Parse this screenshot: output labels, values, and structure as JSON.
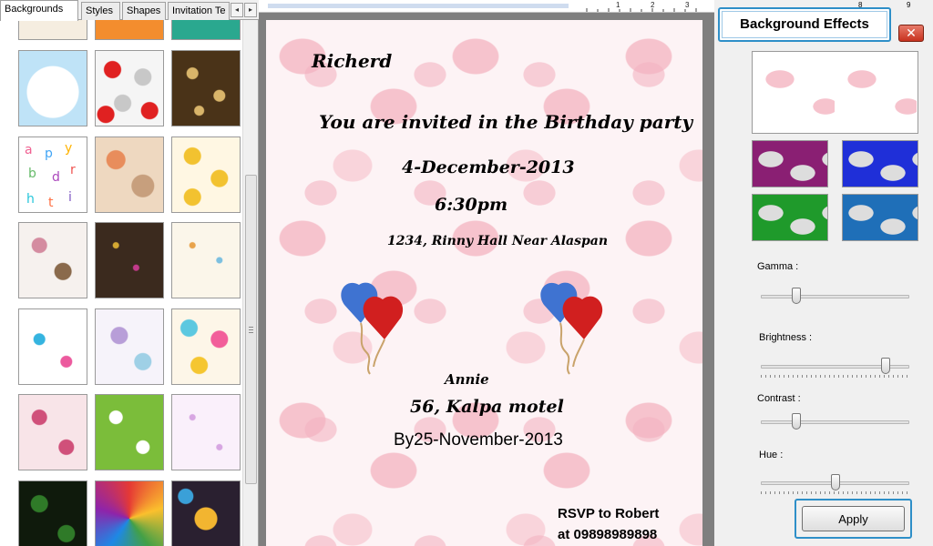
{
  "tabs": [
    {
      "label": "Backgrounds",
      "active": true
    },
    {
      "label": "Styles",
      "active": false
    },
    {
      "label": "Shapes",
      "active": false
    },
    {
      "label": "Invitation Te",
      "active": false
    }
  ],
  "tab_scroll": {
    "left": "◂",
    "right": "▸"
  },
  "ruler_numbers": [
    "1",
    "2",
    "3",
    "8",
    "9"
  ],
  "card": {
    "name": "Richerd",
    "invite": "You are invited in the Birthday party",
    "date": "4-December-2013",
    "time": "6:30pm",
    "venue": "1234, Rinny Hall Near Alaspan",
    "host": "Annie",
    "address": "56, Kalpa motel",
    "rsvp_by": "By25-November-2013",
    "rsvp_to": "RSVP to Robert",
    "phone": "at 09898989898"
  },
  "panel": {
    "title": "Background Effects",
    "close_glyph": "✕",
    "sliders": [
      {
        "label": "Gamma :",
        "value_percent": 22
      },
      {
        "label": "Brightness :",
        "value_percent": 86
      },
      {
        "label": "Contrast :",
        "value_percent": 22
      },
      {
        "label": "Hue :",
        "value_percent": 50
      }
    ],
    "apply_label": "Apply"
  },
  "colors": {
    "accent_border": "#2e8fc8",
    "close_button": "#c8321f"
  }
}
